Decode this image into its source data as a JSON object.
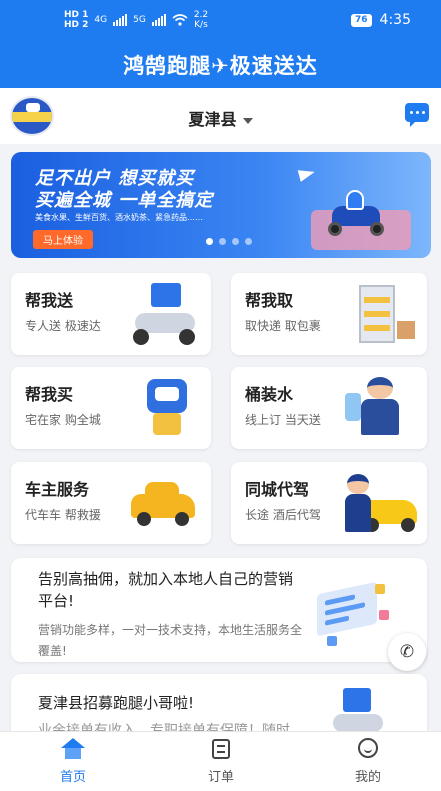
{
  "status_bar": {
    "hd1": "HD 1",
    "hd2": "HD 2",
    "net1": "4G",
    "net2": "5G",
    "speed": "2.2",
    "speed_unit": "K/s",
    "battery": "76",
    "time": "4:35"
  },
  "app_title": "鸿鹄跑腿✈极速送达",
  "location": {
    "city": "夏津县"
  },
  "banner": {
    "line1": "足不出户  想买就买",
    "line2": "买遍全城  一单全搞定",
    "line3": "美食水果、生鲜百货、酒水奶茶、紧急药品……",
    "cta": "马上体验",
    "slide_count": 4,
    "active_slide": 1
  },
  "services": [
    {
      "title": "帮我送",
      "subtitle": "专人送 极速达",
      "icon": "courier-scooter-icon"
    },
    {
      "title": "帮我取",
      "subtitle": "取快递 取包裹",
      "icon": "parcel-locker-icon"
    },
    {
      "title": "帮我买",
      "subtitle": "宅在家 购全城",
      "icon": "shopping-robot-icon"
    },
    {
      "title": "桶装水",
      "subtitle": "线上订 当天送",
      "icon": "water-delivery-icon"
    },
    {
      "title": "车主服务",
      "subtitle": "代车车 帮救援",
      "icon": "car-repair-icon"
    },
    {
      "title": "同城代驾",
      "subtitle": "长途 酒后代驾",
      "icon": "chauffeur-icon"
    }
  ],
  "promos": [
    {
      "title": "告别高抽佣，就加入本地人自己的营销平台!",
      "desc": "营销功能多样，一对一技术支持，本地生活服务全覆盖!"
    },
    {
      "title": "夏津县招募跑腿小哥啦!",
      "desc": "业余接单有收入，专职接单有保障！随时"
    }
  ],
  "tabs": [
    {
      "label": "首页",
      "icon": "home-icon",
      "active": true
    },
    {
      "label": "订单",
      "icon": "order-icon",
      "active": false
    },
    {
      "label": "我的",
      "icon": "profile-icon",
      "active": false
    }
  ],
  "colors": {
    "primary": "#1f7bf0",
    "cta": "#ff6a2a"
  }
}
